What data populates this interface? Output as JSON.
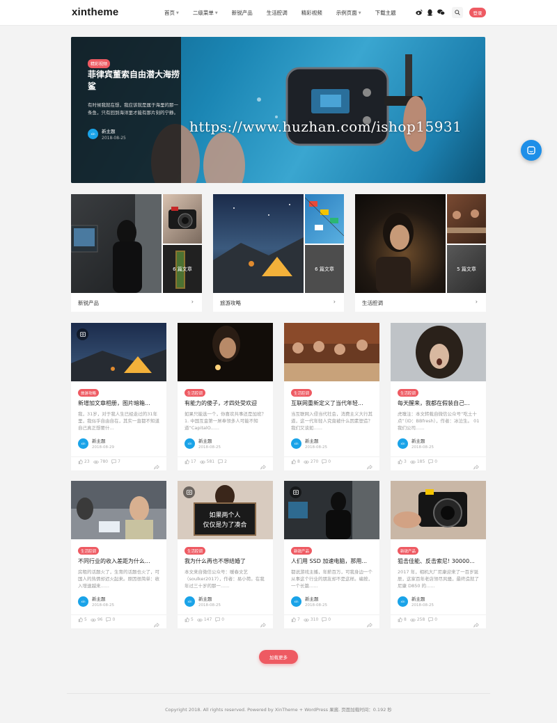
{
  "header": {
    "logo": "xintheme",
    "nav": [
      {
        "label": "首页",
        "has_caret": true
      },
      {
        "label": "二级菜单",
        "has_caret": true
      },
      {
        "label": "新锐产品",
        "has_caret": false
      },
      {
        "label": "生活腔调",
        "has_caret": false
      },
      {
        "label": "精彩视频",
        "has_caret": false
      },
      {
        "label": "示例页面",
        "has_caret": true
      },
      {
        "label": "下载主题",
        "has_caret": false
      }
    ],
    "login_label": "登录",
    "icons": [
      "weibo-icon",
      "qq-icon",
      "wechat-icon",
      "search-icon"
    ]
  },
  "hero": {
    "category": "精彩视频",
    "title": "菲律宾董索自由潜大海捞鲨",
    "excerpt": "有时候我就在想，我应该就是属于海里的那一条鱼，只有回到海洋里才能有那片刻的宁静。",
    "author": "新主题",
    "date": "2018-08-25",
    "watermark": "https://www.huzhan.com/ishop15931"
  },
  "categories": [
    {
      "name": "新锐产品",
      "count": "6 篇文章"
    },
    {
      "name": "旅游攻略",
      "count": "6 篇文章"
    },
    {
      "name": "生活腔调",
      "count": "5 篇文章"
    }
  ],
  "posts": [
    {
      "tag": "旅游攻略",
      "title": "新增加文章相册，图片暗箱...",
      "excerpt": "我，31岁，对于我人生已经走过的31年里，我似乎自由自在，其实一直都不知道自己真正想要什...",
      "author": "新主题",
      "date": "2018-08-29",
      "likes": "23",
      "views": "780",
      "comments": "7"
    },
    {
      "tag": "生活腔调",
      "title": "有能力的傻子，才四处受欢迎",
      "excerpt": "如果只能选一个，你喜欢共事还是加班？ 1. 中国互金第一屌奉领多人可能不知道“CapitalO......",
      "author": "新主题",
      "date": "2018-08-25",
      "likes": "17",
      "views": "581",
      "comments": "2"
    },
    {
      "tag": "生活腔调",
      "title": "互联网重新定义了当代年轻...",
      "excerpt": "当互联网入侵当代社会，消费主义大行其道，这一代年轻人究竟被什么因素塑造？我们又谈如......",
      "author": "新主题",
      "date": "2018-08-25",
      "likes": "8",
      "views": "270",
      "comments": "0"
    },
    {
      "tag": "生活腔调",
      "title": "每天醒来，我都在假装自己...",
      "excerpt": "虎嗅注：本文转载自微信公众号“吃土十点”（ID：BBfresh），作者：冰泣生。 01 我们公司......",
      "author": "新主题",
      "date": "2018-08-25",
      "likes": "3",
      "views": "185",
      "comments": "0"
    },
    {
      "tag": "生活腔调",
      "title": "不同行业的收入差距为什么...",
      "excerpt": "房租的话题火了，生育的话题也火了，可国人的热情却迟火起来。原因很简单：收入增速越来......",
      "author": "新主题",
      "date": "2018-08-25",
      "likes": "5",
      "views": "96",
      "comments": "0"
    },
    {
      "tag": "生活腔调",
      "title": "我为什么再也不想结婚了",
      "excerpt": "本文来自微信公众号：暖春文艺（soulker2017），作者：易小荷。在我年过三十岁的那一......",
      "author": "新主题",
      "date": "2018-08-25",
      "likes": "5",
      "views": "147",
      "comments": "0"
    },
    {
      "tag": "新锐产品",
      "title": "人们用 SSD 加速电脑，那用...",
      "excerpt": "都说游戏主播，年薪百万，可我身边一个从事这个行业的朋友却不是这样。编按，一个长篇......",
      "author": "新主题",
      "date": "2018-08-25",
      "likes": "7",
      "views": "310",
      "comments": "0"
    },
    {
      "tag": "新锐产品",
      "title": "狙击佳能、反击索尼! 30000...",
      "excerpt": "2017 年，相机大厂尼康迎来了一百岁诞辰，这家百年老店领尽风骚，最终造就了尼康 D850 的......",
      "author": "新主题",
      "date": "2018-08-25",
      "likes": "8",
      "views": "258",
      "comments": "0"
    }
  ],
  "load_more": "加载更多",
  "footer": "Copyright 2018. All rights reserved.  Powered by  XinTheme + WordPress 果酱. 页面加载时间：0.192 秒",
  "colors": {
    "accent": "#ee5a62",
    "float_button": "#1e8fe8"
  }
}
